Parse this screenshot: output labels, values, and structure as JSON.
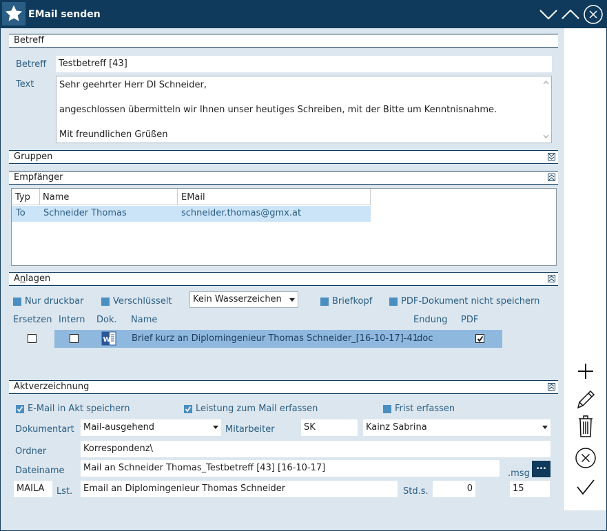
{
  "window": {
    "title": "EMail senden"
  },
  "betreff_section": {
    "heading": "Betreff",
    "betreff_label": "Betreff",
    "betreff_value": "Testbetreff [43]",
    "text_label": "Text",
    "text_lines": [
      "Sehr geehrter Herr DI Schneider,",
      "angeschlossen übermitteln wir Ihnen unser heutiges Schreiben, mit der Bitte um Kenntnisnahme.",
      "Mit freundlichen Grüßen"
    ]
  },
  "gruppen_section": {
    "heading": "Gruppen"
  },
  "empfaenger_section": {
    "heading": "Empfänger",
    "columns": [
      "Typ",
      "Name",
      "EMail"
    ],
    "rows": [
      {
        "typ": "To",
        "name": "Schneider Thomas",
        "email": "schneider.thomas@gmx.at"
      }
    ]
  },
  "anlagen_section": {
    "heading_pre": "A",
    "heading_ul": "n",
    "heading_post": "lagen",
    "nur_druckbar": "Nur druckbar",
    "verschluesselt": "Verschlüsselt",
    "wasserzeichen": "Kein Wasserzeichen",
    "briefkopf": "Briefkopf",
    "pdf_nicht_speichern": "PDF-Dokument nicht speichern",
    "columns": [
      "Ersetzen",
      "Intern",
      "Dok.",
      "Name",
      "Endung",
      "PDF"
    ],
    "rows": [
      {
        "ersetzen": false,
        "intern": false,
        "name": "Brief kurz an Diplomingenieur Thomas Schneider_[16-10-17]-41",
        "endung": ".doc",
        "pdf": true
      }
    ]
  },
  "akt_section": {
    "heading": "Aktverzeichnung",
    "email_in_akt": "E-Mail in Akt speichern",
    "email_in_akt_checked": true,
    "leistung": "Leistung zum Mail erfassen",
    "leistung_checked": true,
    "frist": "Frist erfassen",
    "frist_checked": false,
    "dokumentart_label": "Dokumentart",
    "dokumentart_value": "Mail-ausgehend",
    "mitarbeiter_label": "Mitarbeiter",
    "mitarbeiter_kuerzel": "SK",
    "mitarbeiter_name": "Kainz Sabrina",
    "ordner_label": "Ordner",
    "ordner_value": "Korrespondenz\\",
    "dateiname_label": "Dateiname",
    "dateiname_value": "Mail an Schneider Thomas_Testbetreff [43] [16-10-17]",
    "dateiname_ext": ".msg",
    "browse_label": "...",
    "lst_code": "MAILA",
    "lst_label": "Lst.",
    "lst_value": "Email an Diplomingenieur Thomas Schneider",
    "stds_label": "Std.s.",
    "stds_value": "0",
    "extra_value": "15"
  },
  "icons": {
    "title": "star-icon",
    "minimize": "chevron-down-icon",
    "maximize": "chevron-up-icon",
    "close": "close-circle-icon",
    "add": "plus-icon",
    "edit": "pencil-icon",
    "delete": "trash-icon",
    "cancel": "cancel-circle-icon",
    "confirm": "checkmark-icon"
  },
  "colors": {
    "titlebar": "#0f3a5c",
    "panel": "#dce6ee",
    "accent": "#4a8ec2",
    "label": "#2a5e85",
    "selection": "#cce4f7",
    "attachment_row": "#8fb8de"
  }
}
